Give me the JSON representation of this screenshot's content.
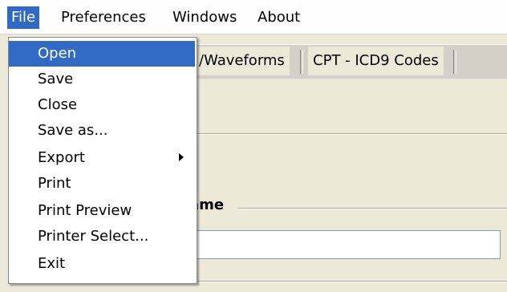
{
  "menubar": {
    "items": [
      {
        "label": "File"
      },
      {
        "label": "Preferences"
      },
      {
        "label": "Windows"
      },
      {
        "label": "About"
      }
    ],
    "active_index": 0
  },
  "tabs": [
    {
      "label": "/Waveforms"
    },
    {
      "label": "CPT - ICD9 Codes"
    }
  ],
  "group": {
    "label": "ame"
  },
  "file_menu": {
    "items": [
      {
        "label": "Open"
      },
      {
        "label": "Save"
      },
      {
        "label": "Close"
      },
      {
        "label": "Save as..."
      },
      {
        "label": "Export"
      },
      {
        "label": "Print"
      },
      {
        "label": "Print Preview"
      },
      {
        "label": "Printer Select..."
      },
      {
        "label": "Exit"
      }
    ],
    "highlighted_index": 0,
    "submenu_index": 4
  },
  "colors": {
    "highlight": "#316ac5",
    "window_bg": "#ece9d8",
    "menubar_bg": "#fefefe"
  }
}
